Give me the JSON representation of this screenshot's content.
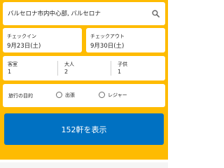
{
  "search": {
    "destination": "バルセロナ市内中心部, バルセロナ",
    "search_icon": "search-icon"
  },
  "dates": {
    "checkin_label": "チェックイン",
    "checkin_value": "9月23日(土)",
    "checkout_label": "チェックアウト",
    "checkout_value": "9月30日(土)"
  },
  "occupancy": {
    "rooms_label": "客室",
    "rooms_value": "1",
    "adults_label": "大人",
    "adults_value": "2",
    "children_label": "子供",
    "children_value": "1"
  },
  "purpose": {
    "label": "旅行の目的",
    "options": [
      {
        "label": "出張",
        "selected": false
      },
      {
        "label": "レジャー",
        "selected": false
      }
    ]
  },
  "submit": {
    "label": "152軒を表示"
  },
  "colors": {
    "panel": "#febb02",
    "button": "#0071c2",
    "text": "#262626"
  }
}
